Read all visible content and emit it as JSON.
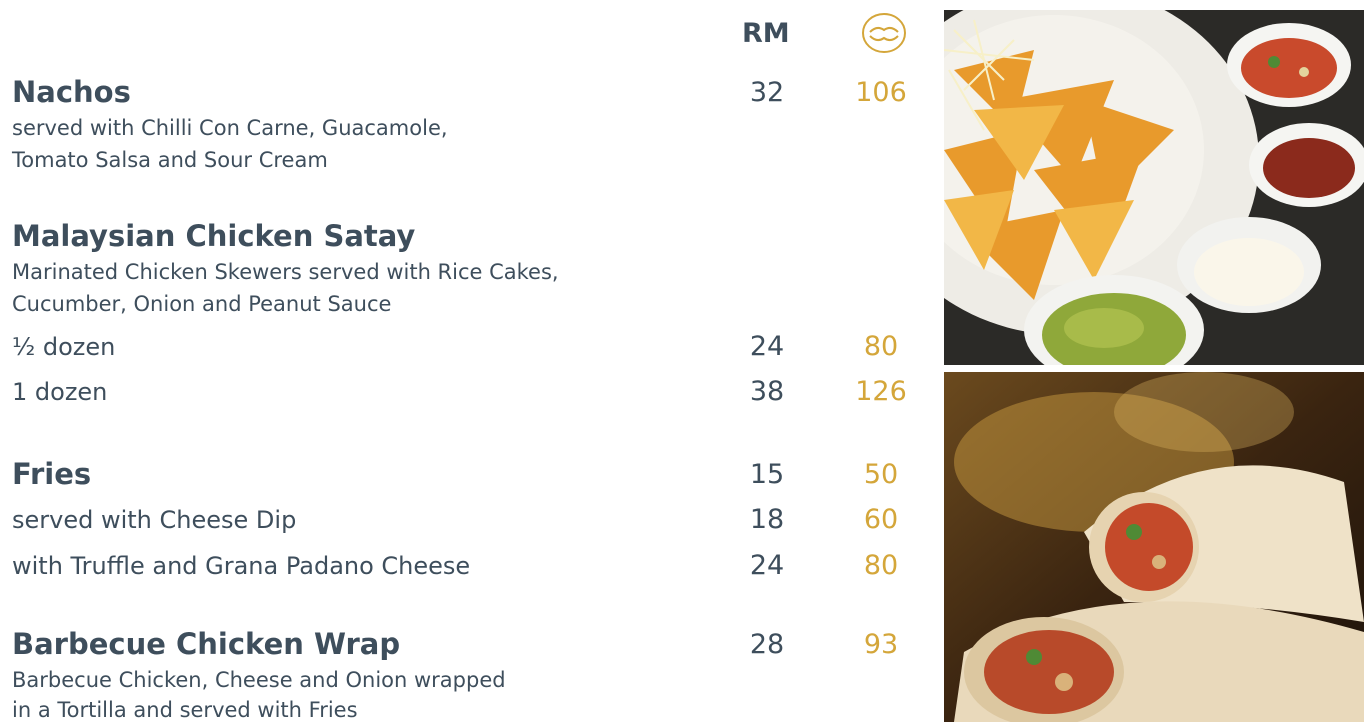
{
  "header": {
    "currency_label": "RM",
    "points_icon": "points-logo-icon"
  },
  "items": [
    {
      "title": "Nachos",
      "desc": [
        "served with Chilli Con Carne, Guacamole,",
        "Tomato Salsa and Sour Cream"
      ],
      "rm": "32",
      "pts": "106"
    },
    {
      "title": "Malaysian Chicken Satay",
      "desc": [
        "Marinated Chicken Skewers served with Rice Cakes,",
        "Cucumber, Onion and Peanut Sauce"
      ],
      "options": [
        {
          "label": "½ dozen",
          "rm": "24",
          "pts": "80"
        },
        {
          "label": "1 dozen",
          "rm": "38",
          "pts": "126"
        }
      ]
    },
    {
      "title": "Fries",
      "rm": "15",
      "pts": "50",
      "options": [
        {
          "label": "served with Cheese Dip",
          "rm": "18",
          "pts": "60"
        },
        {
          "label": "with Truffle and Grana Padano Cheese",
          "rm": "24",
          "pts": "80"
        }
      ]
    },
    {
      "title": "Barbecue Chicken Wrap",
      "desc": [
        "Barbecue Chicken, Cheese and Onion wrapped",
        "in a Tortilla and served with Fries"
      ],
      "rm": "28",
      "pts": "93"
    }
  ],
  "colors": {
    "text": "#3e4e5c",
    "points": "#d4a63a"
  },
  "images": [
    "nachos-photo",
    "chicken-wrap-photo"
  ]
}
